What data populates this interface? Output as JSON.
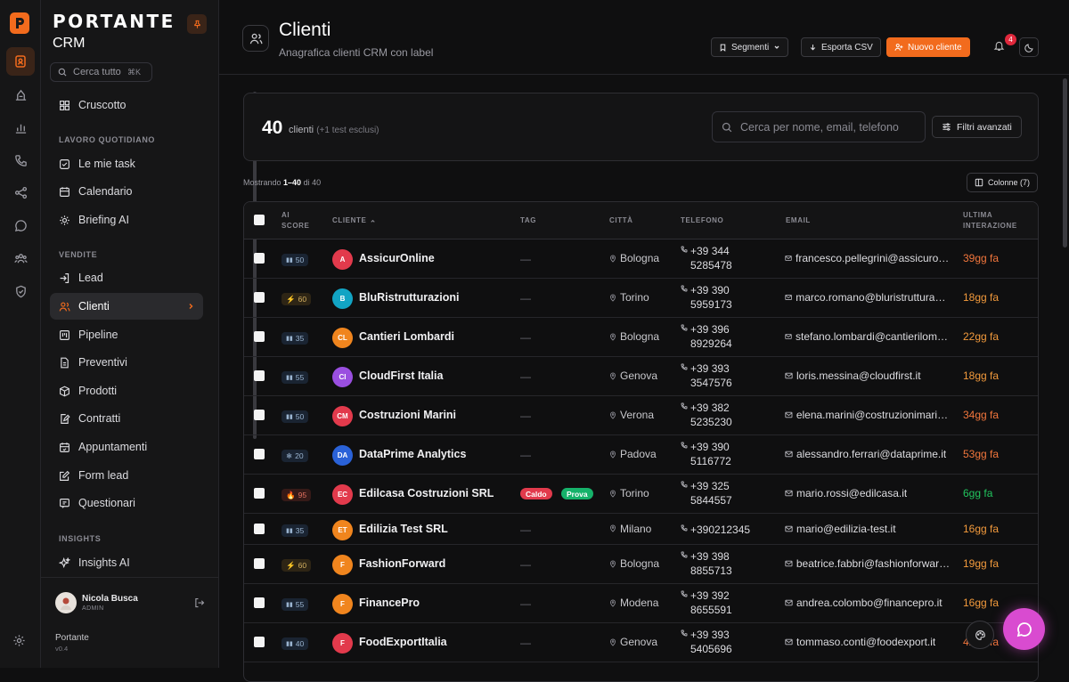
{
  "sidebar": {
    "brand": "PORTANTE",
    "brand_sub": "CRM",
    "search_placeholder": "Cerca tutto",
    "search_kbd": "⌘K",
    "dashboard": "Cruscotto",
    "section_daily": "LAVORO QUOTIDIANO",
    "daily_items": [
      "Le mie task",
      "Calendario",
      "Briefing AI"
    ],
    "section_sales": "VENDITE",
    "sales_items": [
      "Lead",
      "Clienti",
      "Pipeline",
      "Preventivi",
      "Prodotti",
      "Contratti",
      "Appuntamenti",
      "Form lead",
      "Questionari"
    ],
    "section_insights": "INSIGHTS",
    "insights_items": [
      "Insights AI"
    ],
    "user_name": "Nicola Busca",
    "user_role": "ADMIN",
    "app_name": "Portante",
    "app_version": "v0.4"
  },
  "header": {
    "title": "Clienti",
    "subtitle": "Anagrafica clienti CRM con label",
    "segments": "Segmenti",
    "export": "Esporta CSV",
    "new_client": "Nuovo cliente",
    "notifications": "4"
  },
  "summary": {
    "count": "40",
    "count_label": "clienti",
    "count_note": "(+1 test esclusi)",
    "search_placeholder": "Cerca per nome, email, telefono",
    "filters": "Filtri avanzati"
  },
  "list": {
    "showing_prefix": "Mostrando ",
    "showing_range": "1–40",
    "showing_suffix": " di 40",
    "columns_btn": "Colonne (7)"
  },
  "table": {
    "headers": {
      "ai": "AI",
      "score": "SCORE",
      "client": "CLIENTE",
      "tag": "TAG",
      "city": "CITTÀ",
      "phone": "TELEFONO",
      "email": "EMAIL",
      "last1": "ULTIMA",
      "last2": "INTERAZIONE"
    },
    "rows": [
      {
        "score": "50",
        "kind": "cold",
        "initials": "A",
        "color": "#e23a4c",
        "name": "AssicurOnline",
        "tag": "—",
        "city": "Bologna",
        "phone1": "+39 344",
        "phone2": "5285478",
        "email": "francesco.pellegrini@assicuronline.it",
        "last": "39gg fa",
        "last_color": "#f2763c"
      },
      {
        "score": "60",
        "kind": "warm",
        "initials": "B",
        "color": "#12a4c4",
        "name": "BluRistrutturazioni",
        "tag": "—",
        "city": "Torino",
        "phone1": "+39 390",
        "phone2": "5959173",
        "email": "marco.romano@bluristrutturazioni.it",
        "last": "18gg fa",
        "last_color": "#f29a3c"
      },
      {
        "score": "35",
        "kind": "cold",
        "initials": "CL",
        "color": "#f0851e",
        "name": "Cantieri Lombardi",
        "tag": "—",
        "city": "Bologna",
        "phone1": "+39 396",
        "phone2": "8929264",
        "email": "stefano.lombardi@cantierilombardi.it",
        "last": "22gg fa",
        "last_color": "#f29a3c"
      },
      {
        "score": "55",
        "kind": "cold",
        "initials": "CI",
        "color": "#9a4fe0",
        "name": "CloudFirst Italia",
        "tag": "—",
        "city": "Genova",
        "phone1": "+39 393",
        "phone2": "3547576",
        "email": "loris.messina@cloudfirst.it",
        "last": "18gg fa",
        "last_color": "#f29a3c"
      },
      {
        "score": "50",
        "kind": "cold",
        "initials": "CM",
        "color": "#e23a4c",
        "name": "Costruzioni Marini",
        "tag": "—",
        "city": "Verona",
        "phone1": "+39 382",
        "phone2": "5235230",
        "email": "elena.marini@costruzionimarini.it",
        "last": "34gg fa",
        "last_color": "#f2763c"
      },
      {
        "score": "20",
        "kind": "cold",
        "initials": "DA",
        "color": "#2a62d8",
        "name": "DataPrime Analytics",
        "tag": "—",
        "city": "Padova",
        "phone1": "+39 390",
        "phone2": "5116772",
        "email": "alessandro.ferrari@dataprime.it",
        "last": "53gg fa",
        "last_color": "#f2763c"
      },
      {
        "score": "95",
        "kind": "hot",
        "initials": "EC",
        "color": "#e23a4c",
        "name": "Edilcasa Costruzioni SRL",
        "tags": [
          "Caldo",
          "Prova"
        ],
        "city": "Torino",
        "phone1": "+39 325",
        "phone2": "5844557",
        "email": "mario.rossi@edilcasa.it",
        "last": "6gg fa",
        "last_color": "#22c55e"
      },
      {
        "score": "35",
        "kind": "cold",
        "initials": "ET",
        "color": "#f0851e",
        "name": "Edilizia Test SRL",
        "tag": "—",
        "city": "Milano",
        "phone1": "+390212345",
        "phone2": "",
        "email": "mario@edilizia-test.it",
        "last": "16gg fa",
        "last_color": "#f29a3c"
      },
      {
        "score": "60",
        "kind": "warm",
        "initials": "F",
        "color": "#f0851e",
        "name": "FashionForward",
        "tag": "—",
        "city": "Bologna",
        "phone1": "+39 398",
        "phone2": "8855713",
        "email": "beatrice.fabbri@fashionforward.it",
        "last": "19gg fa",
        "last_color": "#f29a3c"
      },
      {
        "score": "55",
        "kind": "cold",
        "initials": "F",
        "color": "#f0851e",
        "name": "FinancePro",
        "tag": "—",
        "city": "Modena",
        "phone1": "+39 392",
        "phone2": "8655591",
        "email": "andrea.colombo@financepro.it",
        "last": "16gg fa",
        "last_color": "#f29a3c"
      },
      {
        "score": "40",
        "kind": "cold",
        "initials": "F",
        "color": "#e23a4c",
        "name": "FoodExportItalia",
        "tag": "—",
        "city": "Genova",
        "phone1": "+39 393",
        "phone2": "5405696",
        "email": "tommaso.conti@foodexport.it",
        "last": "42gg fa",
        "last_color": "#f2763c"
      }
    ],
    "tag_colors": {
      "Caldo": "#e23a4c",
      "Prova": "#16b26a"
    }
  }
}
